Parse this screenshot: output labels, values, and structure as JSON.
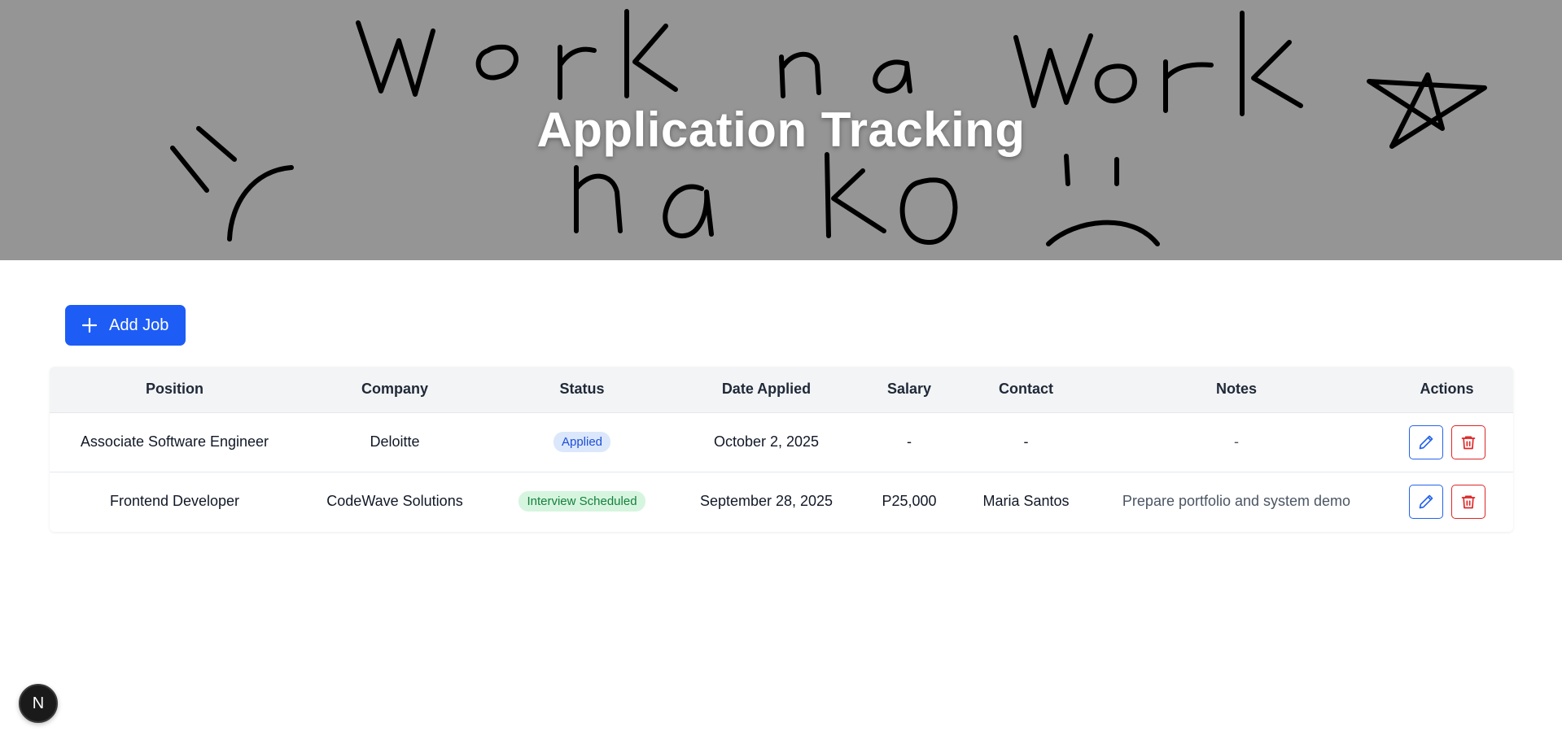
{
  "banner": {
    "title": "Application Tracking",
    "background_color": "#959595",
    "scribble_icon": "handwritten-scribble-icon"
  },
  "toolbar": {
    "add_label": "Add Job",
    "add_icon": "plus-icon",
    "accent_color": "#1d5cf5"
  },
  "table": {
    "columns": [
      "Position",
      "Company",
      "Status",
      "Date Applied",
      "Salary",
      "Contact",
      "Notes",
      "Actions"
    ],
    "rows": [
      {
        "position": "Associate Software Engineer",
        "company": "Deloitte",
        "status": "Applied",
        "date_applied": "October 2, 2025",
        "salary": "-",
        "contact": "-",
        "notes": "-"
      },
      {
        "position": "Frontend Developer",
        "company": "CodeWave Solutions",
        "status": "Interview Scheduled",
        "date_applied": "September 28, 2025",
        "salary": "P25,000",
        "contact": "Maria Santos",
        "notes": "Prepare portfolio and system demo"
      }
    ],
    "edit_icon": "pencil-icon",
    "delete_icon": "trash-icon",
    "status_colors": {
      "Applied": "#1d4ed8",
      "Interview Scheduled": "#15803d"
    }
  },
  "dev_badge": {
    "label": "N",
    "icon": "nextjs-logo-icon"
  }
}
